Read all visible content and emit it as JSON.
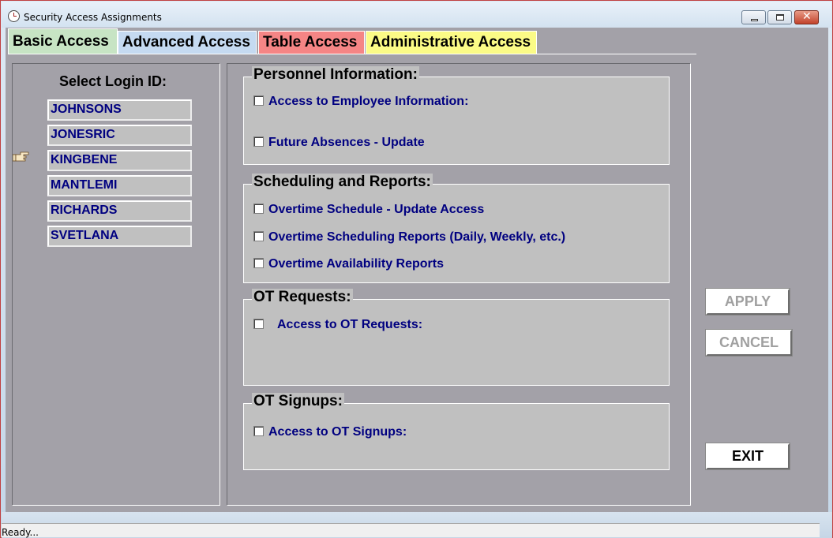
{
  "window": {
    "title": "Security Access Assignments"
  },
  "tabs": [
    {
      "label": "Basic Access",
      "color": "#c7e4c4",
      "active": true
    },
    {
      "label": "Advanced Access",
      "color": "#c5daf1",
      "active": false
    },
    {
      "label": "Table Access",
      "color": "#f58585",
      "active": false
    },
    {
      "label": "Administrative Access",
      "color": "#fbfb86",
      "active": false
    }
  ],
  "login_panel": {
    "title": "Select Login ID:",
    "items": [
      "JOHNSONS",
      "JONESRIC",
      "KINGBENE",
      "MANTLEMI",
      "RICHARDS",
      "SVETLANA"
    ],
    "selected": "KINGBENE",
    "pointer_icon": "pointing-hand-icon"
  },
  "groups": {
    "personnel": {
      "title": "Personnel Information:",
      "options": [
        {
          "label": "Access to Employee Information:",
          "checked": false
        },
        {
          "label": "Future Absences - Update",
          "checked": false
        }
      ]
    },
    "scheduling": {
      "title": "Scheduling and Reports:",
      "options": [
        {
          "label": "Overtime Schedule - Update Access",
          "checked": false
        },
        {
          "label": "Overtime Scheduling Reports (Daily, Weekly, etc.)",
          "checked": false
        },
        {
          "label": "Overtime Availability Reports",
          "checked": false
        }
      ]
    },
    "ot_requests": {
      "title": "OT Requests:",
      "options": [
        {
          "label": "Access to OT Requests:",
          "checked": false
        }
      ]
    },
    "ot_signups": {
      "title": "OT Signups:",
      "options": [
        {
          "label": "Access to OT Signups:",
          "checked": false
        }
      ]
    }
  },
  "buttons": {
    "apply": "APPLY",
    "cancel": "CANCEL",
    "exit": "EXIT"
  },
  "status": {
    "text": "Ready..."
  },
  "colors": {
    "client_bg": "#a3a1a8",
    "group_bg": "#c0c0c0",
    "label_color": "#000080",
    "window_border": "#c04040"
  }
}
